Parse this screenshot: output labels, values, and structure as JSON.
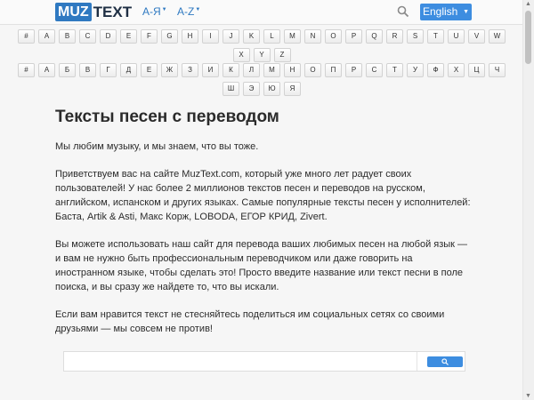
{
  "header": {
    "logo_box": "MUZ",
    "logo_text": "TEXT",
    "nav_cyr": "А-Я",
    "nav_lat": "A-Z",
    "language": "English"
  },
  "letters_latin": [
    "#",
    "A",
    "B",
    "C",
    "D",
    "E",
    "F",
    "G",
    "H",
    "I",
    "J",
    "K",
    "L",
    "M",
    "N",
    "O",
    "P",
    "Q",
    "R",
    "S",
    "T",
    "U",
    "V",
    "W",
    "X",
    "Y",
    "Z"
  ],
  "letters_cyrillic": [
    "#",
    "А",
    "Б",
    "В",
    "Г",
    "Д",
    "Е",
    "Ж",
    "З",
    "И",
    "К",
    "Л",
    "М",
    "Н",
    "О",
    "П",
    "Р",
    "С",
    "Т",
    "У",
    "Ф",
    "Х",
    "Ц",
    "Ч",
    "Ш",
    "Э",
    "Ю",
    "Я"
  ],
  "content": {
    "title": "Тексты песен с переводом",
    "paragraphs": [
      "Мы любим музыку, и мы знаем, что вы тоже.",
      "Приветствуем вас на сайте MuzText.com, который уже много лет радует своих пользователей! У нас более 2 миллионов текстов песен и переводов на русском, английском, испанском и других языках. Самые популярные тексты песен у исполнителей: Баста, Artik & Asti, Макс Корж, LOBODA, ЕГОР КРИД, Zivert.",
      "Вы можете использовать наш сайт для перевода ваших любимых песен на любой язык — и вам не нужно быть профессиональным переводчиком или даже говорить на иностранном языке, чтобы сделать это! Просто введите название или текст песни в поле поиска, и вы сразу же найдете то, что вы искали.",
      "Если вам нравится текст не стесняйтесь поделиться им социальных сетях со своими друзьями — мы совсем не против!"
    ]
  },
  "colors": {
    "brand": "#2f79c1",
    "button": "#3d8de0"
  }
}
